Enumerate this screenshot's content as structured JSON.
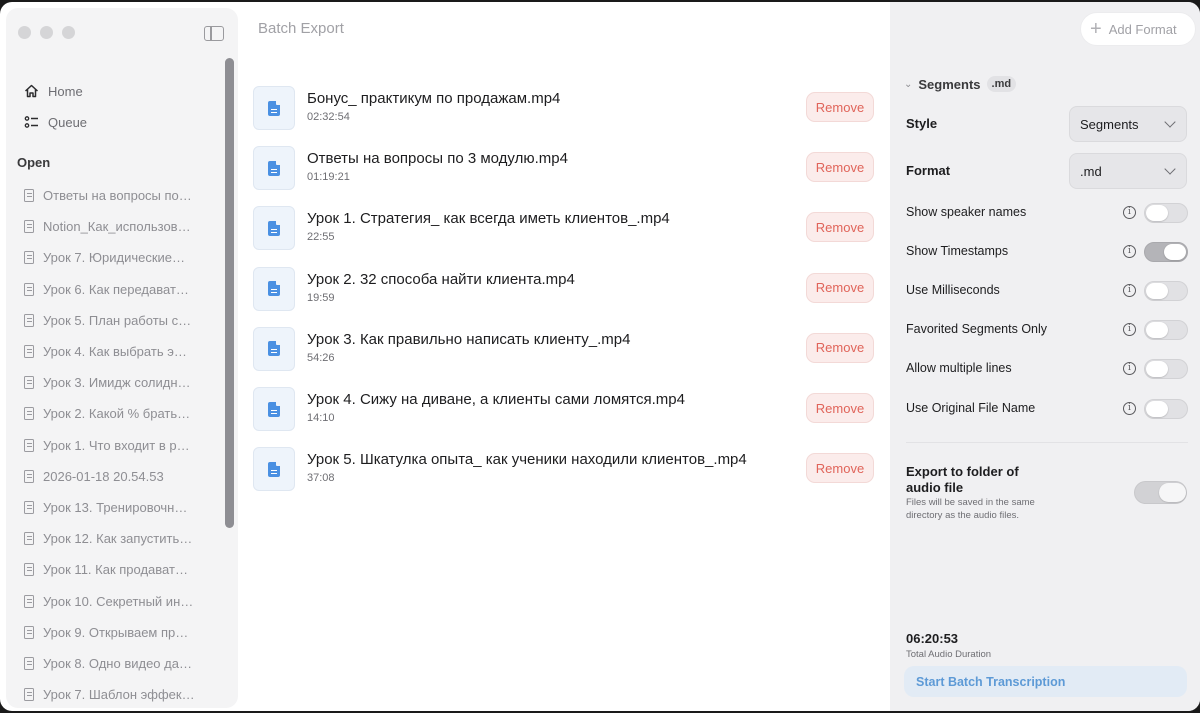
{
  "sidebar": {
    "nav": [
      {
        "label": "Home",
        "icon": "home-icon"
      },
      {
        "label": "Queue",
        "icon": "queue-icon"
      }
    ],
    "open_label": "Open",
    "open_items": [
      "Ответы на вопросы по…",
      "Notion_Как_использов…",
      "Урок 7. Юридические…",
      "Урок 6. Как передават…",
      "Урок 5. План работы с…",
      "Урок 4. Как выбрать э…",
      "Урок 3. Имидж солидн…",
      "Урок 2. Какой % брать…",
      "Урок 1. Что входит в р…",
      "2026-01-18 20.54.53",
      "Урок 13. Тренировочн…",
      "Урок 12. Как запустить…",
      "Урок 11. Как продават…",
      "Урок 10. Секретный ин…",
      "Урок 9. Открываем пр…",
      "Урок 8. Одно видео да…",
      "Урок 7. Шаблон эффек…"
    ]
  },
  "main": {
    "title": "Batch Export",
    "remove_label": "Remove",
    "files": [
      {
        "name": "Бонус_ практикум по продажам.mp4",
        "duration": "02:32:54"
      },
      {
        "name": "Ответы на вопросы по 3 модулю.mp4",
        "duration": "01:19:21"
      },
      {
        "name": "Урок 1. Стратегия_ как всегда иметь клиентов_.mp4",
        "duration": "22:55"
      },
      {
        "name": "Урок 2. 32 способа найти клиента.mp4",
        "duration": "19:59"
      },
      {
        "name": "Урок 3. Как правильно написать клиенту_.mp4",
        "duration": "54:26"
      },
      {
        "name": "Урок 4. Сижу на диване, а клиенты сами ломятся.mp4",
        "duration": "14:10"
      },
      {
        "name": "Урок 5. Шкатулка опыта_ как ученики находили клиентов_.mp4",
        "duration": "37:08"
      }
    ]
  },
  "panel": {
    "add_format": "Add Format",
    "segments_title": "Segments",
    "segments_badge": ".md",
    "style_label": "Style",
    "style_value": "Segments",
    "format_label": "Format",
    "format_value": ".md",
    "toggles": [
      {
        "label": "Show speaker names",
        "on": false
      },
      {
        "label": "Show Timestamps",
        "on": true
      },
      {
        "label": "Use Milliseconds",
        "on": false
      },
      {
        "label": "Favorited Segments Only",
        "on": false
      },
      {
        "label": "Allow multiple lines",
        "on": false
      },
      {
        "label": "Use Original File Name",
        "on": false
      }
    ],
    "export_label": "Export to folder of audio file",
    "export_desc": "Files will be saved in the same directory as the audio files.",
    "export_on": true,
    "total_time": "06:20:53",
    "total_label": "Total Audio Duration",
    "start_button": "Start Batch Transcription"
  }
}
